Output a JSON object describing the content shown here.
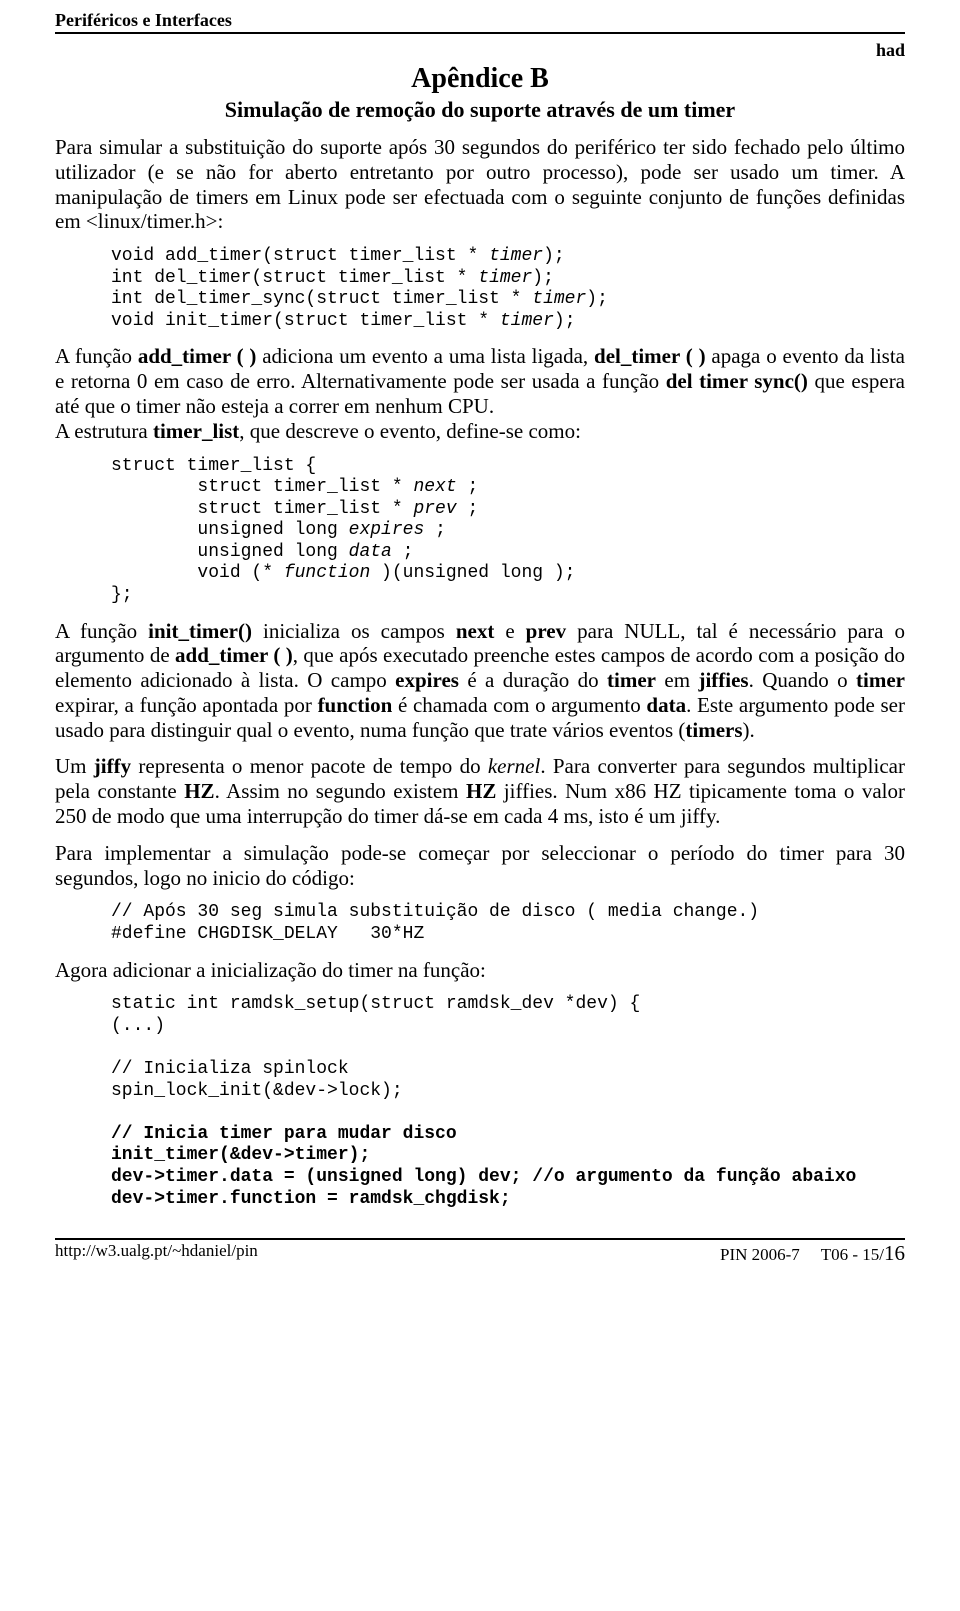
{
  "header": {
    "title": "Periféricos e Interfaces",
    "had": "had"
  },
  "appendix": {
    "title": "Apêndice B",
    "subtitle": "Simulação de remoção do suporte através de um timer"
  },
  "para1": "Para simular a substituição do suporte após 30 segundos do periférico ter sido fechado pelo último utilizador (e se não for aberto entretanto por outro processo), pode ser usado um timer. A manipulação de timers em Linux pode ser efectuada com o seguinte conjunto de funções definidas em <linux/timer.h>:",
  "code1": {
    "l1a": "void add_timer(struct timer_list * ",
    "l1b": "timer",
    "l1c": ");",
    "l2a": "int del_timer(struct timer_list * ",
    "l2b": "timer",
    "l2c": ");",
    "l3a": "int del_timer_sync(struct timer_list * ",
    "l3b": "timer",
    "l3c": ");",
    "l4a": "void init_timer(struct timer_list * ",
    "l4b": "timer",
    "l4c": ");"
  },
  "para2": {
    "t1": "A função ",
    "b1": "add_timer ( )",
    "t2": " adiciona um evento a uma lista ligada, ",
    "b2": "del_timer ( )",
    "t3": " apaga o evento da lista e retorna 0 em caso de erro. Alternativamente pode ser usada a função ",
    "b3": "del timer sync()",
    "t4": " que espera até que o timer não esteja a correr em nenhum CPU."
  },
  "para3": {
    "t1": "A estrutura ",
    "b1": "timer_list",
    "t2": ", que descreve o evento, define-se como:"
  },
  "code2": {
    "l1": "struct timer_list {",
    "l2a": "        struct timer_list * ",
    "l2b": "next",
    "l2c": " ;",
    "l3a": "        struct timer_list * ",
    "l3b": "prev",
    "l3c": " ;",
    "l4a": "        unsigned long ",
    "l4b": "expires",
    "l4c": " ;",
    "l5a": "        unsigned long ",
    "l5b": "data",
    "l5c": " ;",
    "l6a": "        void (* ",
    "l6b": "function",
    "l6c": " )(unsigned long );",
    "l7": "};"
  },
  "para4": {
    "t1": "A função ",
    "b1": "init_timer()",
    "t2": " inicializa os campos ",
    "b2": "next",
    "t3": " e ",
    "b3": "prev",
    "t4": " para NULL, tal é necessário para o argumento de ",
    "b4": "add_timer ( )",
    "t5": ", que após executado preenche estes campos de acordo com a posição do elemento adicionado à lista. O campo ",
    "b5": "expires",
    "t6": " é a duração do ",
    "b6": "timer",
    "t7": " em ",
    "b7": "jiffies",
    "t8": ". Quando o ",
    "b8": "timer",
    "t9": " expirar, a função apontada por ",
    "b9": "function",
    "t10": " é chamada com o argumento ",
    "b10": "data",
    "t11": ". Este argumento pode ser usado para distinguir qual o evento, numa função que trate vários eventos (",
    "b11": "timers",
    "t12": ")."
  },
  "para5": {
    "t1": "Um ",
    "b1": "jiffy",
    "t2": " representa o menor pacote de tempo do ",
    "i1": "kernel",
    "t3": ". Para converter para segundos multiplicar pela constante ",
    "b2": "HZ",
    "t4": ". Assim no segundo existem ",
    "b3": "HZ",
    "t5": " jiffies. Num x86 HZ tipicamente toma o valor 250 de modo que uma interrupção do timer dá-se em cada 4 ms, isto é um jiffy."
  },
  "para6": "Para implementar a simulação pode-se começar por seleccionar o período do timer para 30 segundos, logo no inicio do código:",
  "code3": {
    "l1": "// Após 30 seg simula substituição de disco ( media change.)",
    "l2": "#define CHGDISK_DELAY   30*HZ"
  },
  "para7": "Agora adicionar a inicialização do timer na função:",
  "code4": {
    "l1": "static int ramdsk_setup(struct ramdsk_dev *dev) {",
    "l2": "(...)",
    "blank1": " ",
    "l3": "// Inicializa spinlock",
    "l4": "spin_lock_init(&dev->lock);",
    "blank2": " ",
    "l5": "// Inicia timer para mudar disco",
    "l6": "init_timer(&dev->timer);",
    "l7": "dev->timer.data = (unsigned long) dev; //o argumento da função abaixo",
    "l8": "dev->timer.function = ramdsk_chgdisk;"
  },
  "footer": {
    "left": "http://w3.ualg.pt/~hdaniel/pin",
    "right_a": "PIN 2006-7     T06 - 15/",
    "right_b": "16"
  }
}
